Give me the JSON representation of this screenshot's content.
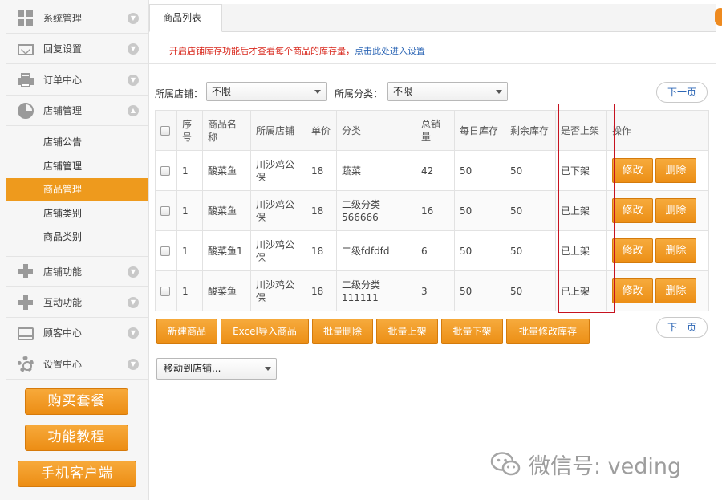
{
  "sidebar": {
    "menu": [
      {
        "label": "系统管理",
        "icon": "grid-icon"
      },
      {
        "label": "回复设置",
        "icon": "mail-icon"
      },
      {
        "label": "订单中心",
        "icon": "printer-icon"
      },
      {
        "label": "店铺管理",
        "icon": "pie-chart-icon"
      }
    ],
    "submenu": [
      "店铺公告",
      "店铺管理",
      "商品管理",
      "店铺类别",
      "商品类别"
    ],
    "menu2": [
      {
        "label": "店铺功能",
        "icon": "plus-icon"
      },
      {
        "label": "互动功能",
        "icon": "plus-icon"
      },
      {
        "label": "顾客中心",
        "icon": "tray-icon"
      },
      {
        "label": "设置中心",
        "icon": "gear-icon"
      }
    ],
    "buttons": [
      "购买套餐",
      "功能教程",
      "手机客户端"
    ]
  },
  "tabs": {
    "active": "商品列表"
  },
  "notice": {
    "text": "开启店铺库存功能后才查看每个商品的库存量，",
    "link": "点击此处进入设置"
  },
  "filters": {
    "store_label": "所属店铺：",
    "store_value": "不限",
    "category_label": "所属分类：",
    "category_value": "不限"
  },
  "pager": {
    "next": "下一页"
  },
  "table": {
    "headers": [
      "序号",
      "商品名称",
      "所属店铺",
      "单价",
      "分类",
      "总销量",
      "每日库存",
      "剩余库存",
      "是否上架",
      "操作"
    ],
    "rows": [
      {
        "no": "1",
        "name": "酸菜鱼",
        "store": "川沙鸡公保",
        "price": "18",
        "category": "蔬菜",
        "sales": "42",
        "daily": "50",
        "remain": "50",
        "status": "已下架"
      },
      {
        "no": "1",
        "name": "酸菜鱼",
        "store": "川沙鸡公保",
        "price": "18",
        "category": "二级分类 566666",
        "sales": "16",
        "daily": "50",
        "remain": "50",
        "status": "已上架"
      },
      {
        "no": "1",
        "name": "酸菜鱼1",
        "store": "川沙鸡公保",
        "price": "18",
        "category": "二级fdfdfd",
        "sales": "6",
        "daily": "50",
        "remain": "50",
        "status": "已上架"
      },
      {
        "no": "1",
        "name": "酸菜鱼",
        "store": "川沙鸡公保",
        "price": "18",
        "category": "二级分类 111111",
        "sales": "3",
        "daily": "50",
        "remain": "50",
        "status": "已上架"
      }
    ],
    "edit_label": "修改",
    "delete_label": "删除"
  },
  "bulk_actions": [
    "新建商品",
    "Excel导入商品",
    "批量删除",
    "批量上架",
    "批量下架",
    "批量修改库存"
  ],
  "move_select": {
    "value": "移动到店铺..."
  },
  "watermark": {
    "text": "微信号: veding"
  },
  "colors": {
    "accent": "#ee9a1d",
    "link": "#2a64b4",
    "notice": "#d8271c"
  }
}
